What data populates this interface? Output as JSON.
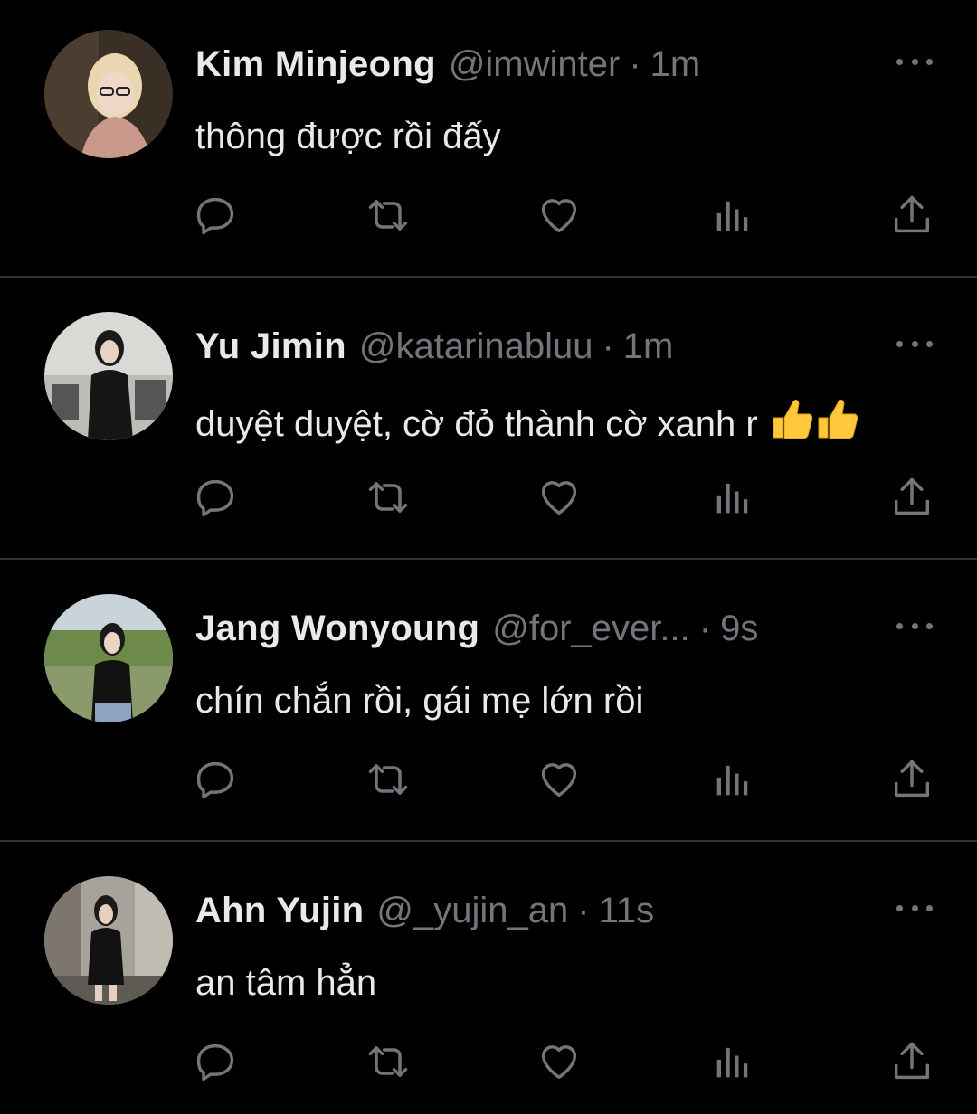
{
  "colors": {
    "background": "#000000",
    "primary_text": "#e7e9ea",
    "secondary_text": "#71767b",
    "divider": "#2f3336"
  },
  "tweets": [
    {
      "name": "Kim Minjeong",
      "handle": "@imwinter",
      "separator": "·",
      "time": "1m",
      "text": "thông được rồi đấy",
      "emoji": "",
      "avatar": "avatar-photo-1"
    },
    {
      "name": "Yu Jimin",
      "handle": "@katarinabluu",
      "separator": "·",
      "time": "1m",
      "text": "duyệt duyệt, cờ đỏ thành cờ xanh r",
      "emoji": "thumbs-up-icon x2",
      "avatar": "avatar-photo-2"
    },
    {
      "name": "Jang Wonyoung",
      "handle": "@for_ever...",
      "separator": "·",
      "time": "9s",
      "text": "chín chắn rồi, gái mẹ lớn rồi",
      "emoji": "",
      "avatar": "avatar-photo-3"
    },
    {
      "name": "Ahn Yujin",
      "handle": "@_yujin_an",
      "separator": "·",
      "time": "11s",
      "text": "an tâm hẳn",
      "emoji": "",
      "avatar": "avatar-photo-4"
    }
  ],
  "action_icons": [
    "reply-icon",
    "retweet-icon",
    "like-icon",
    "views-icon",
    "share-icon"
  ],
  "more_icon": "more-options-icon"
}
